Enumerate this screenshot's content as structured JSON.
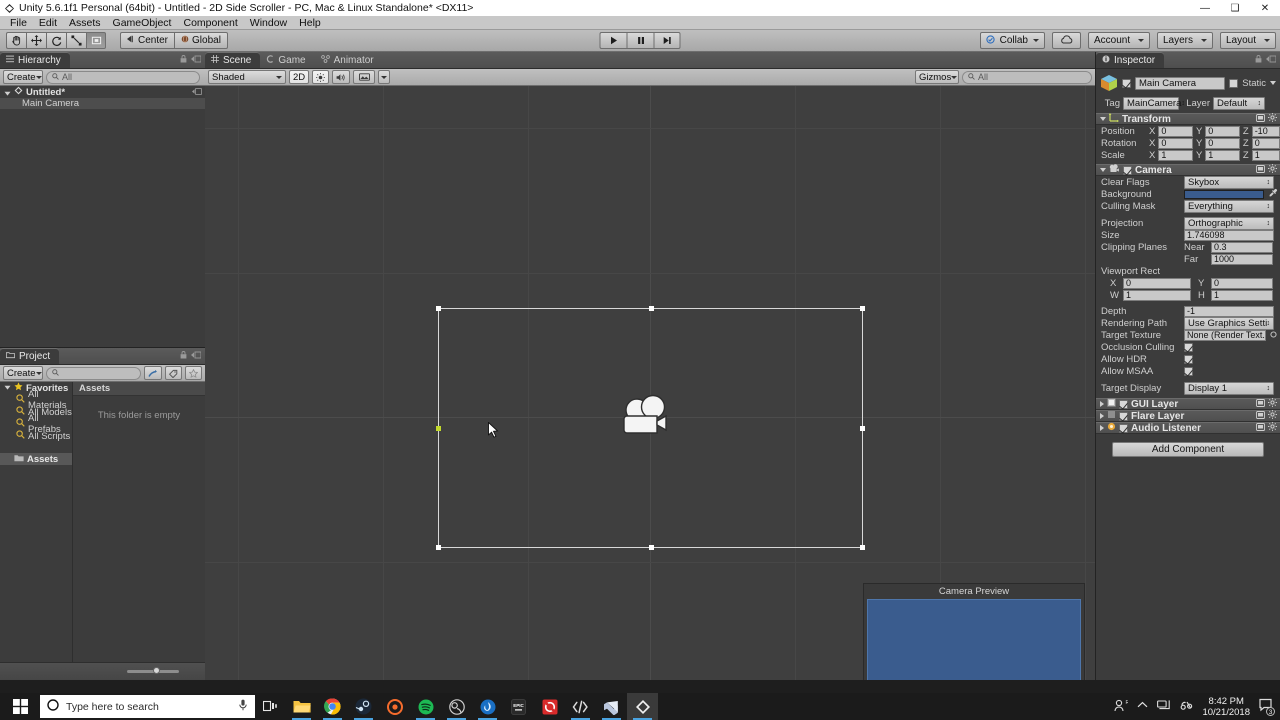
{
  "window": {
    "title": "Unity 5.6.1f1 Personal (64bit) - Untitled - 2D Side Scroller - PC, Mac & Linux Standalone* <DX11>",
    "minimize": "—",
    "maximize": "❑",
    "close": "✕"
  },
  "menu": {
    "items": [
      "File",
      "Edit",
      "Assets",
      "GameObject",
      "Component",
      "Window",
      "Help"
    ]
  },
  "toolbar": {
    "tools": [
      {
        "name": "hand-tool",
        "icon": "hand-icon",
        "active": false
      },
      {
        "name": "move-tool",
        "icon": "move-icon",
        "active": false
      },
      {
        "name": "rotate-tool",
        "icon": "rotate-icon",
        "active": false
      },
      {
        "name": "scale-tool",
        "icon": "scale-icon",
        "active": false
      },
      {
        "name": "rect-tool",
        "icon": "rect-transform-icon",
        "active": true
      }
    ],
    "pivot_label": "Center",
    "handle_label": "Global",
    "play_buttons": [
      "play-icon",
      "pause-icon",
      "step-icon"
    ],
    "collab_label": "Collab",
    "cloud_label": "cloud-icon",
    "account_label": "Account",
    "layers_label": "Layers",
    "layout_label": "Layout"
  },
  "hierarchy": {
    "tab": "Hierarchy",
    "create_label": "Create",
    "search_placeholder": "All",
    "scene_name": "Untitled*",
    "items": [
      {
        "label": "Main Camera",
        "selected": true
      }
    ]
  },
  "project": {
    "tab": "Project",
    "create_label": "Create",
    "search_placeholder": "",
    "favorites_label": "Favorites",
    "favorites": [
      "All Materials",
      "All Models",
      "All Prefabs",
      "All Scripts"
    ],
    "assets_label": "Assets",
    "column_header": "Assets",
    "empty_message": "This folder is empty"
  },
  "scene": {
    "tabs": [
      {
        "label": "Scene",
        "active": true,
        "icon": "scene-icon"
      },
      {
        "label": "Game",
        "active": false,
        "icon": "game-icon"
      },
      {
        "label": "Animator",
        "active": false,
        "icon": "animator-icon"
      }
    ],
    "shading_mode": "Shaded",
    "mode_2d": "2D",
    "lighting_icon": "lighting-icon",
    "audio_icon": "audio-icon",
    "effects_icon": "effects-icon",
    "gizmos_label": "Gizmos",
    "gizmos_search_placeholder": "All",
    "camera_preview_title": "Camera Preview",
    "camera_preview_color": "#3a5c8e"
  },
  "inspector": {
    "tab": "Inspector",
    "object_name": "Main Camera",
    "enabled": true,
    "static_label": "Static",
    "tag_label": "Tag",
    "tag_value": "MainCamera",
    "layer_label": "Layer",
    "layer_value": "Default",
    "transform": {
      "title": "Transform",
      "rows": [
        {
          "label": "Position",
          "x": "0",
          "y": "0",
          "z": "-10"
        },
        {
          "label": "Rotation",
          "x": "0",
          "y": "0",
          "z": "0"
        },
        {
          "label": "Scale",
          "x": "1",
          "y": "1",
          "z": "1"
        }
      ],
      "axes": [
        "X",
        "Y",
        "Z"
      ]
    },
    "camera": {
      "title": "Camera",
      "enabled": true,
      "clear_flags_label": "Clear Flags",
      "clear_flags_value": "Skybox",
      "background_label": "Background",
      "background_color": "#3a5c8e",
      "culling_mask_label": "Culling Mask",
      "culling_mask_value": "Everything",
      "projection_label": "Projection",
      "projection_value": "Orthographic",
      "size_label": "Size",
      "size_value": "1.746098",
      "clipping_planes_label": "Clipping Planes",
      "near_label": "Near",
      "near_value": "0.3",
      "far_label": "Far",
      "far_value": "1000",
      "viewport_rect_label": "Viewport Rect",
      "viewport": {
        "x_label": "X",
        "x_value": "0",
        "y_label": "Y",
        "y_value": "0",
        "w_label": "W",
        "w_value": "1",
        "h_label": "H",
        "h_value": "1"
      },
      "depth_label": "Depth",
      "depth_value": "-1",
      "rendering_path_label": "Rendering Path",
      "rendering_path_value": "Use Graphics Settings",
      "target_texture_label": "Target Texture",
      "target_texture_value": "None (Render Text.",
      "occlusion_culling_label": "Occlusion Culling",
      "occlusion_culling": true,
      "allow_hdr_label": "Allow HDR",
      "allow_hdr": true,
      "allow_msaa_label": "Allow MSAA",
      "allow_msaa": true,
      "target_display_label": "Target Display",
      "target_display_value": "Display 1"
    },
    "components": [
      {
        "label": "GUI Layer",
        "enabled": true,
        "icon": "gui-layer-icon"
      },
      {
        "label": "Flare Layer",
        "enabled": true,
        "icon": "flare-layer-icon"
      },
      {
        "label": "Audio Listener",
        "enabled": true,
        "icon": "audio-listener-icon"
      }
    ],
    "add_component_label": "Add Component"
  },
  "taskbar": {
    "start_label": "start-icon",
    "search_placeholder": "Type here to search",
    "mic_icon": "microphone-icon",
    "taskview_icon": "task-view-icon",
    "apps": [
      {
        "name": "file-explorer",
        "running": true
      },
      {
        "name": "google-chrome",
        "running": true
      },
      {
        "name": "steam",
        "running": true
      },
      {
        "name": "origin",
        "running": false
      },
      {
        "name": "spotify",
        "running": true
      },
      {
        "name": "obs-studio",
        "running": true
      },
      {
        "name": "blizzard-battlenet",
        "running": true
      },
      {
        "name": "epic-games",
        "running": false
      },
      {
        "name": "dvd-ripper",
        "running": false
      },
      {
        "name": "visual-studio-code",
        "running": true
      },
      {
        "name": "visual-studio",
        "running": true
      },
      {
        "name": "unity",
        "running": true,
        "active": true
      }
    ],
    "tray": {
      "people_icon": "people-icon",
      "chevron_icon": "show-hidden-icons-icon",
      "network_icon": "network-icon",
      "volume_icon": "volume-icon",
      "time": "8:42 PM",
      "date": "10/21/2018",
      "notifications_count": "3"
    }
  }
}
